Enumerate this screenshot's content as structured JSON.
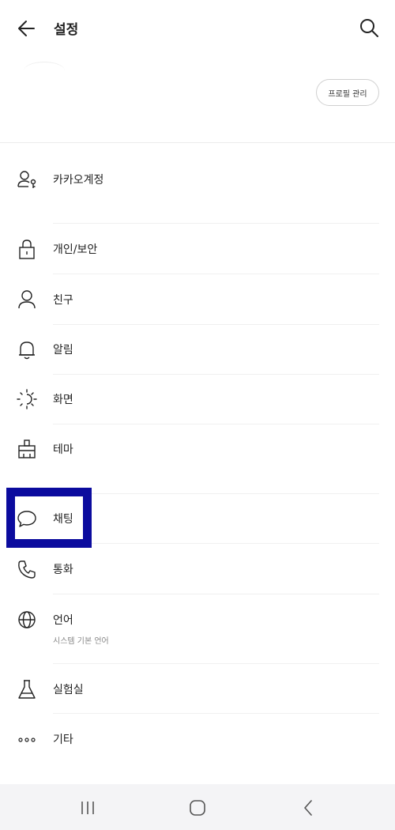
{
  "header": {
    "title": "설정",
    "back_icon": "arrow-left-icon",
    "search_icon": "search-icon"
  },
  "profile": {
    "manage_label": "프로필 관리"
  },
  "menu": [
    {
      "id": "kakao-account",
      "label": "카카오계정",
      "icon": "person-key-icon"
    },
    {
      "id": "privacy",
      "label": "개인/보안",
      "icon": "lock-icon"
    },
    {
      "id": "friends",
      "label": "친구",
      "icon": "person-icon"
    },
    {
      "id": "notifications",
      "label": "알림",
      "icon": "bell-icon"
    },
    {
      "id": "display",
      "label": "화면",
      "icon": "brightness-icon"
    },
    {
      "id": "theme",
      "label": "테마",
      "icon": "paint-brush-icon"
    },
    {
      "id": "chat",
      "label": "채팅",
      "icon": "chat-bubble-icon"
    },
    {
      "id": "call",
      "label": "통화",
      "icon": "phone-icon"
    },
    {
      "id": "language",
      "label": "언어",
      "sublabel": "시스템 기본 언어",
      "icon": "globe-icon"
    },
    {
      "id": "labs",
      "label": "실험실",
      "icon": "flask-icon"
    },
    {
      "id": "etc",
      "label": "기타",
      "icon": "more-dots-icon"
    }
  ],
  "highlight_color": "#0b0b9e",
  "navbar": {
    "recent_icon": "recent-apps-icon",
    "home_icon": "home-icon",
    "back_icon": "nav-back-icon"
  }
}
